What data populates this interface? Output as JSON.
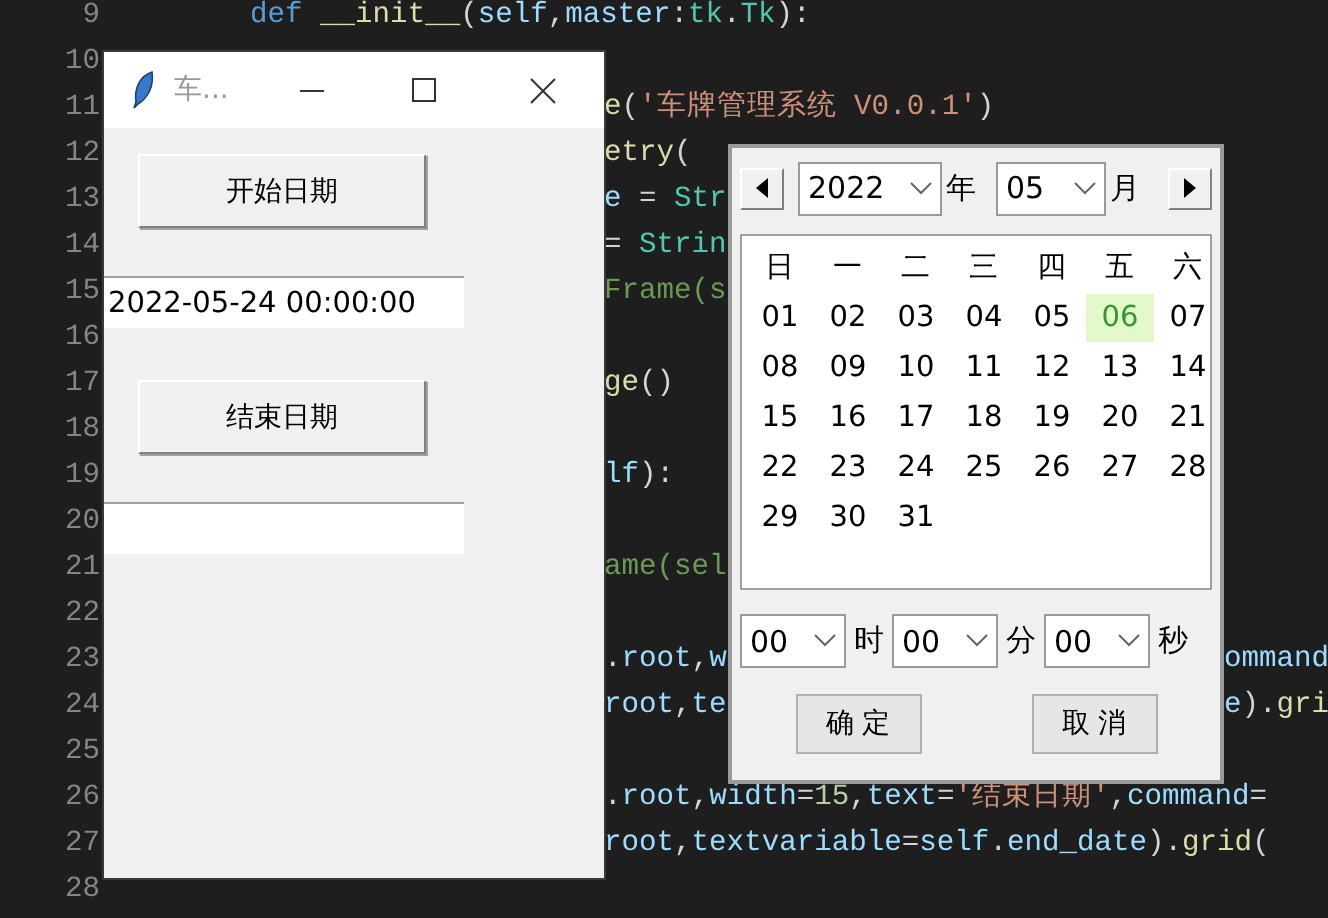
{
  "editor": {
    "lines": [
      {
        "number": "9",
        "segments": [
          {
            "tokens": [
              {
                "text": "def ",
                "kind": "keyword"
              },
              {
                "text": "__init__",
                "kind": "func"
              },
              {
                "text": "(",
                "kind": "plain"
              },
              {
                "text": "self",
                "kind": "name"
              },
              {
                "text": ",",
                "kind": "plain"
              },
              {
                "text": "master",
                "kind": "name"
              },
              {
                "text": ":",
                "kind": "plain"
              },
              {
                "text": "tk",
                "kind": "class"
              },
              {
                "text": ".",
                "kind": "plain"
              },
              {
                "text": "Tk",
                "kind": "class"
              },
              {
                "text": "):",
                "kind": "plain"
              }
            ]
          }
        ]
      },
      {
        "number": "10"
      },
      {
        "number": "11",
        "segments": [
          {
            "tokens": [
              {
                "text": "e",
                "kind": "func"
              },
              {
                "text": "(",
                "kind": "plain"
              },
              {
                "text": "'车牌管理系统 V0.0.1'",
                "kind": "string"
              },
              {
                "text": ")",
                "kind": "plain"
              }
            ]
          }
        ]
      },
      {
        "number": "12",
        "segments": [
          {
            "tokens": [
              {
                "text": "etry",
                "kind": "func"
              },
              {
                "text": "(",
                "kind": "plain"
              }
            ]
          }
        ]
      },
      {
        "number": "13",
        "segments": [
          {
            "tokens": [
              {
                "text": "e",
                "kind": "name"
              },
              {
                "text": " = ",
                "kind": "plain"
              },
              {
                "text": "Str",
                "kind": "class"
              }
            ]
          }
        ]
      },
      {
        "number": "14",
        "segments": [
          {
            "tokens": [
              {
                "text": "= ",
                "kind": "plain"
              },
              {
                "text": "Strin",
                "kind": "class"
              }
            ]
          }
        ]
      },
      {
        "number": "15",
        "segments": [
          {
            "tokens": [
              {
                "text": "Frame(s",
                "kind": "comment"
              }
            ]
          }
        ]
      },
      {
        "number": "16"
      },
      {
        "number": "17",
        "segments": [
          {
            "tokens": [
              {
                "text": "ge",
                "kind": "func"
              },
              {
                "text": "()",
                "kind": "plain"
              }
            ]
          }
        ]
      },
      {
        "number": "18"
      },
      {
        "number": "19",
        "segments": [
          {
            "tokens": [
              {
                "text": "lf",
                "kind": "name"
              },
              {
                "text": "):",
                "kind": "plain"
              }
            ]
          }
        ]
      },
      {
        "number": "20"
      },
      {
        "number": "21",
        "segments": [
          {
            "tokens": [
              {
                "text": "ame(sel",
                "kind": "comment"
              }
            ]
          }
        ]
      },
      {
        "number": "22"
      },
      {
        "number": "23",
        "segments": [
          {
            "tokens": [
              {
                "text": ".",
                "kind": "plain"
              },
              {
                "text": "root",
                "kind": "name"
              },
              {
                "text": ",",
                "kind": "plain"
              },
              {
                "text": "w",
                "kind": "name"
              }
            ]
          },
          {
            "tokens": [
              {
                "text": "ommand",
                "kind": "name"
              }
            ]
          }
        ]
      },
      {
        "number": "24",
        "segments": [
          {
            "tokens": [
              {
                "text": "root",
                "kind": "name"
              },
              {
                "text": ",",
                "kind": "plain"
              },
              {
                "text": "te",
                "kind": "name"
              }
            ]
          },
          {
            "tokens": [
              {
                "text": "e",
                "kind": "name"
              },
              {
                "text": ").",
                "kind": "plain"
              },
              {
                "text": "gri",
                "kind": "func"
              }
            ]
          }
        ]
      },
      {
        "number": "25"
      },
      {
        "number": "26",
        "segments": [
          {
            "tokens": [
              {
                "text": ".",
                "kind": "plain"
              },
              {
                "text": "root",
                "kind": "name"
              },
              {
                "text": ",",
                "kind": "plain"
              },
              {
                "text": "width",
                "kind": "name"
              },
              {
                "text": "=",
                "kind": "plain"
              },
              {
                "text": "15",
                "kind": "number"
              },
              {
                "text": ",",
                "kind": "plain"
              },
              {
                "text": "text",
                "kind": "name"
              },
              {
                "text": "=",
                "kind": "plain"
              },
              {
                "text": "'结束日期'",
                "kind": "string"
              },
              {
                "text": ",",
                "kind": "plain"
              },
              {
                "text": "command",
                "kind": "name"
              },
              {
                "text": "=",
                "kind": "plain"
              }
            ]
          }
        ]
      },
      {
        "number": "27",
        "segments": [
          {
            "tokens": [
              {
                "text": "root",
                "kind": "name"
              },
              {
                "text": ",",
                "kind": "plain"
              },
              {
                "text": "textvariable",
                "kind": "name"
              },
              {
                "text": "=",
                "kind": "plain"
              },
              {
                "text": "self",
                "kind": "name"
              },
              {
                "text": ".",
                "kind": "plain"
              },
              {
                "text": "end_date",
                "kind": "name"
              },
              {
                "text": ").",
                "kind": "plain"
              },
              {
                "text": "grid",
                "kind": "func"
              },
              {
                "text": "(",
                "kind": "plain"
              }
            ]
          }
        ]
      },
      {
        "number": "28"
      }
    ]
  },
  "app_window": {
    "title": "车...",
    "rows": [
      {
        "kind": "button",
        "label": "开始日期"
      },
      {
        "kind": "entry",
        "value": "2022-05-24 00:00:00"
      },
      {
        "kind": "button",
        "label": "结束日期"
      },
      {
        "kind": "entry"
      }
    ]
  },
  "calendar": {
    "year": "2022",
    "year_unit": "年",
    "month": "05",
    "month_unit": "月",
    "weekdays": [
      "日",
      "一",
      "二",
      "三",
      "四",
      "五",
      "六"
    ],
    "days": [
      {
        "label": "01",
        "selected": false
      },
      {
        "label": "02",
        "selected": false
      },
      {
        "label": "03",
        "selected": false
      },
      {
        "label": "04",
        "selected": false
      },
      {
        "label": "05",
        "selected": false
      },
      {
        "label": "06",
        "selected": true
      },
      {
        "label": "07",
        "selected": false
      },
      {
        "label": "08",
        "selected": false
      },
      {
        "label": "09",
        "selected": false
      },
      {
        "label": "10",
        "selected": false
      },
      {
        "label": "11",
        "selected": false
      },
      {
        "label": "12",
        "selected": false
      },
      {
        "label": "13",
        "selected": false
      },
      {
        "label": "14",
        "selected": false
      },
      {
        "label": "15",
        "selected": false
      },
      {
        "label": "16",
        "selected": false
      },
      {
        "label": "17",
        "selected": false
      },
      {
        "label": "18",
        "selected": false
      },
      {
        "label": "19",
        "selected": false
      },
      {
        "label": "20",
        "selected": false
      },
      {
        "label": "21",
        "selected": false
      },
      {
        "label": "22",
        "selected": false
      },
      {
        "label": "23",
        "selected": false
      },
      {
        "label": "24",
        "selected": false
      },
      {
        "label": "25",
        "selected": false
      },
      {
        "label": "26",
        "selected": false
      },
      {
        "label": "27",
        "selected": false
      },
      {
        "label": "28",
        "selected": false
      },
      {
        "label": "29",
        "selected": false
      },
      {
        "label": "30",
        "selected": false
      },
      {
        "label": "31",
        "selected": false
      }
    ],
    "time": [
      {
        "value": "00",
        "unit": "时"
      },
      {
        "value": "00",
        "unit": "分"
      },
      {
        "value": "00",
        "unit": "秒"
      }
    ],
    "buttons": [
      "确 定",
      "取 消"
    ]
  }
}
